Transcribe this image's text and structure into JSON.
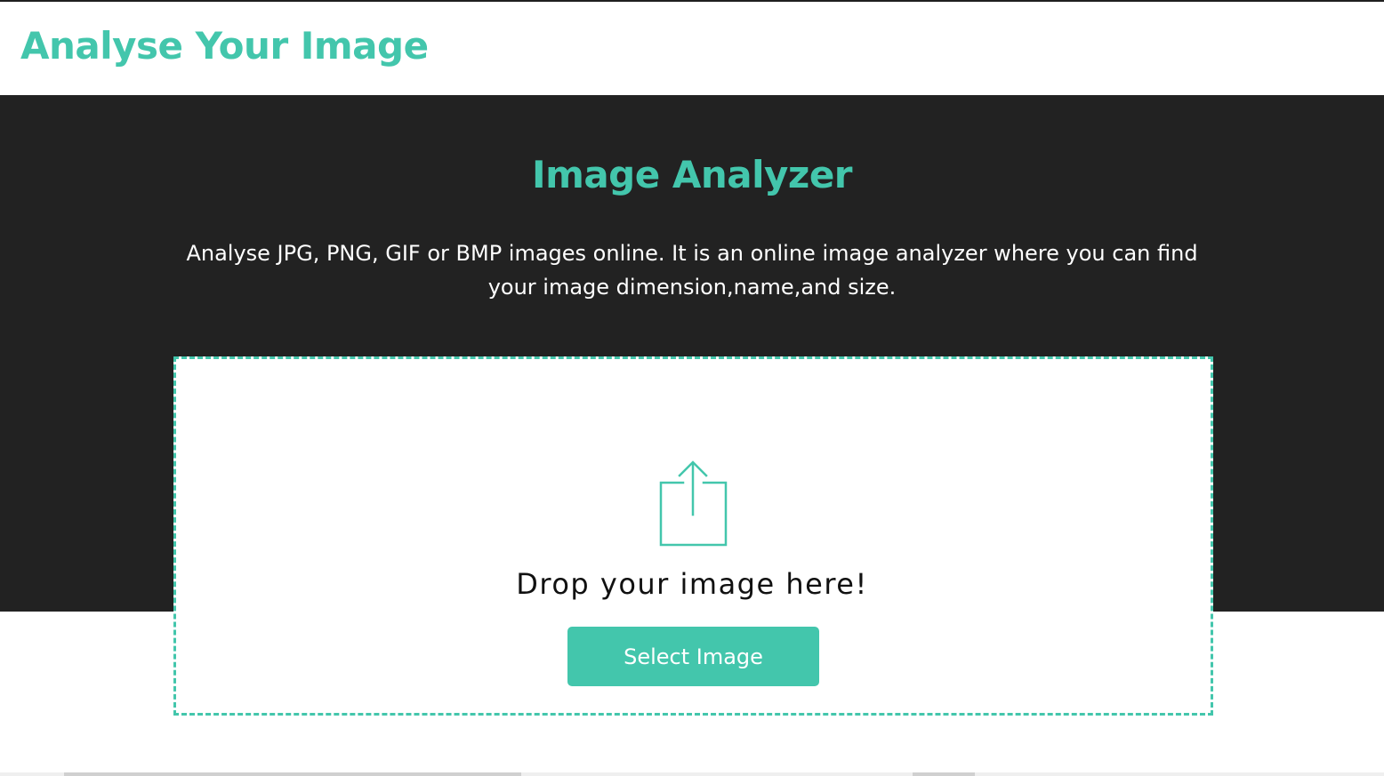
{
  "header": {
    "title": "Analyse Your Image"
  },
  "hero": {
    "title": "Image Analyzer",
    "description": "Analyse JPG, PNG, GIF or BMP images online. It is an online image analyzer where you can find your image dimension,name,and size."
  },
  "drop_zone": {
    "icon": "upload-share-icon",
    "prompt": "Drop your image here!",
    "button_label": "Select Image"
  },
  "colors": {
    "accent": "#43c6ac",
    "hero_background": "#222222",
    "page_background": "#ffffff"
  }
}
